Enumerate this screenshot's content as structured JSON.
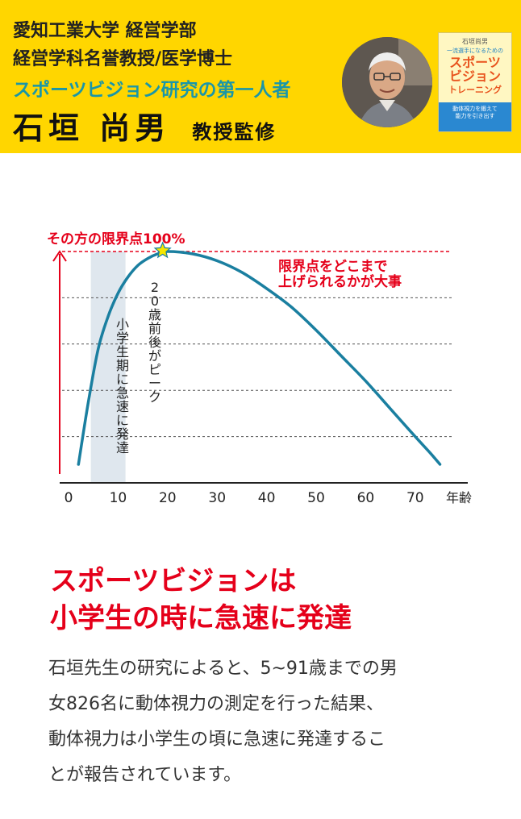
{
  "header": {
    "line1": "愛知工業大学 経営学部",
    "line2": "経営学科名誉教授/医学博士",
    "line3": "スポーツビジョン研究の第一人者",
    "name": "石垣 尚男",
    "role": "教授監修",
    "background_color": "#FFD600",
    "accent_color": "#1a96a8"
  },
  "book": {
    "author": "石垣尚男",
    "subtitle": "一流選手になるための",
    "title_lines": [
      "スポーツ",
      "ビジョン",
      "トレーニング"
    ],
    "band_lines": [
      "動体視力を鍛えて",
      "能力を引き出す"
    ]
  },
  "chart_data": {
    "type": "line",
    "top_label": "その方の限界点100%",
    "xlabel": "年齢",
    "x_ticks": [
      0,
      10,
      20,
      30,
      40,
      50,
      60,
      70
    ],
    "xlim": [
      0,
      80
    ],
    "ylim": [
      0,
      100
    ],
    "grid_levels": [
      20,
      40,
      60,
      80
    ],
    "series": [
      {
        "x": [
          2,
          4,
          6,
          8,
          10,
          12,
          14,
          16,
          18,
          20,
          25,
          30,
          35,
          40,
          45,
          50,
          55,
          60,
          65,
          70,
          73,
          75
        ],
        "y": [
          8,
          35,
          58,
          72,
          82,
          89,
          94,
          97,
          99,
          100,
          99,
          96,
          91,
          84,
          76,
          66,
          55,
          44,
          32,
          20,
          13,
          8
        ]
      }
    ],
    "shaded_band": {
      "x_from": 4.5,
      "x_to": 11.5,
      "label": "小学生期に急速に発達"
    },
    "peak": {
      "x": 19,
      "y": 100,
      "label": "20歳前後がピーク"
    },
    "annotation": [
      "限界点をどこまで",
      "上げられるかが大事"
    ],
    "colors": {
      "line": "#1a7fa0",
      "axis": "#e5001a",
      "band": "#dfe7ee",
      "star": "#f5e600"
    }
  },
  "heading": {
    "lines": [
      "スポーツビジョンは",
      "小学生の時に急速に発達"
    ],
    "color": "#e5001a"
  },
  "body": {
    "lines": [
      "石垣先生の研究によると、5~91歳までの男",
      "女826名に動体視力の測定を行った結果、",
      "動体視力は小学生の頃に急速に発達するこ",
      "とが報告されています。"
    ]
  }
}
